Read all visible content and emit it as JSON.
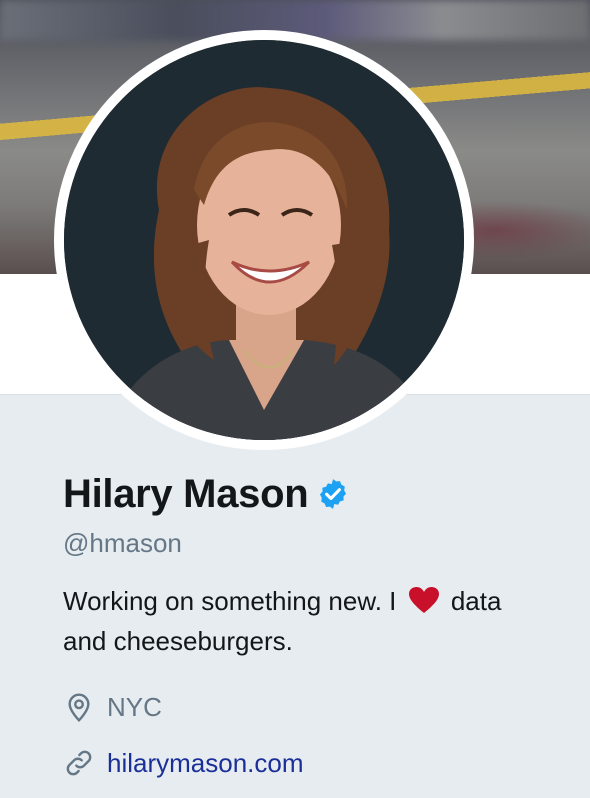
{
  "profile": {
    "name": "Hilary Mason",
    "handle": "@hmason",
    "verified": true,
    "bio_before": "Working on something new. I",
    "bio_after": "data and cheeseburgers.",
    "location": "NYC",
    "website": "hilarymason.com"
  },
  "icons": {
    "verified": "verified-badge-icon",
    "heart": "heart-emoji-icon",
    "location": "location-pin-icon",
    "link": "link-icon"
  },
  "colors": {
    "verified": "#1da1f2",
    "heart": "#c9102b",
    "link": "#1b2f99",
    "muted": "#657786",
    "text": "#14171a"
  }
}
